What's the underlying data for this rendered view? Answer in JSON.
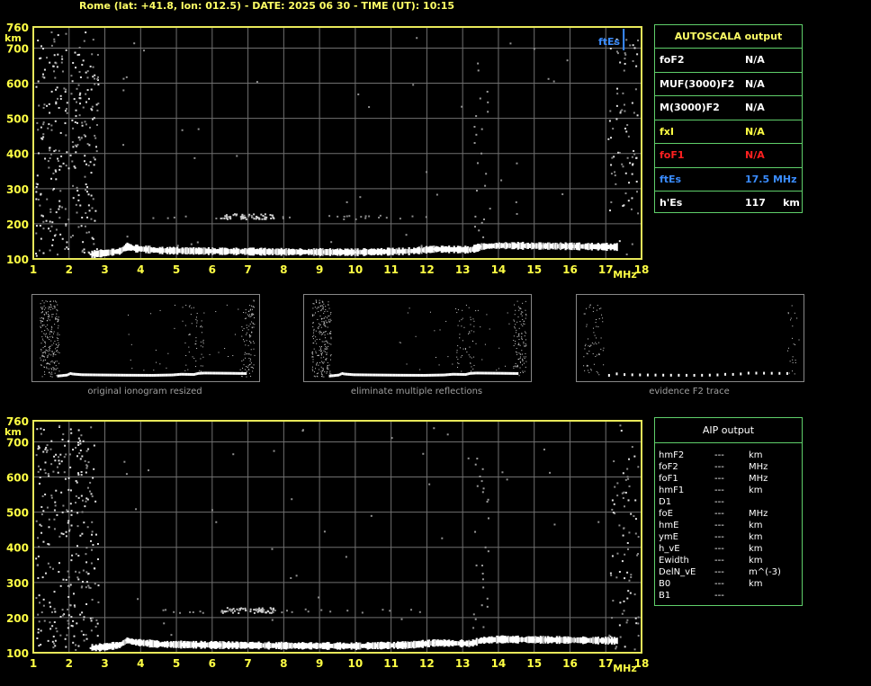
{
  "title": "Rome (lat: +41.8, lon: 012.5) - DATE: 2025 06 30 - TIME (UT): 10:15",
  "chart_data": [
    {
      "type": "scatter",
      "name": "ionogram-top",
      "xlabel": "MHz",
      "ylabel": "km",
      "xlim": [
        1,
        18
      ],
      "ylim": [
        100,
        760
      ],
      "x_ticks": [
        "1",
        "2",
        "3",
        "4",
        "5",
        "6",
        "7",
        "8",
        "9",
        "10",
        "11",
        "12",
        "13",
        "14",
        "15",
        "16",
        "17",
        "18"
      ],
      "y_ticks": [
        "760",
        "700",
        "600",
        "500",
        "400",
        "300",
        "200",
        "100"
      ],
      "trace": [
        [
          2.6,
          113
        ],
        [
          3.0,
          117
        ],
        [
          3.4,
          122
        ],
        [
          3.6,
          135
        ],
        [
          3.8,
          130
        ],
        [
          4.5,
          124
        ],
        [
          6,
          122
        ],
        [
          8,
          120
        ],
        [
          10,
          119
        ],
        [
          11.5,
          122
        ],
        [
          12.2,
          128
        ],
        [
          13.2,
          126
        ],
        [
          13.5,
          135
        ],
        [
          14,
          138
        ],
        [
          15,
          137
        ],
        [
          16,
          136
        ],
        [
          17.3,
          134
        ]
      ],
      "ftEs_marker": {
        "label": "ftEs",
        "x": 17.5,
        "color": "#3a8cff"
      }
    },
    {
      "type": "scatter",
      "name": "ionogram-bottom",
      "xlabel": "MHz",
      "ylabel": "km",
      "xlim": [
        1,
        18
      ],
      "ylim": [
        100,
        760
      ],
      "x_ticks": [
        "1",
        "2",
        "3",
        "4",
        "5",
        "6",
        "7",
        "8",
        "9",
        "10",
        "11",
        "12",
        "13",
        "14",
        "15",
        "16",
        "17",
        "18"
      ],
      "y_ticks": [
        "760",
        "700",
        "600",
        "500",
        "400",
        "300",
        "200",
        "100"
      ],
      "trace": [
        [
          2.6,
          113
        ],
        [
          3.0,
          117
        ],
        [
          3.4,
          122
        ],
        [
          3.6,
          135
        ],
        [
          3.8,
          130
        ],
        [
          4.5,
          124
        ],
        [
          6,
          122
        ],
        [
          8,
          120
        ],
        [
          10,
          119
        ],
        [
          11.5,
          122
        ],
        [
          12.2,
          128
        ],
        [
          13.2,
          126
        ],
        [
          13.5,
          135
        ],
        [
          14,
          138
        ],
        [
          15,
          137
        ],
        [
          16,
          136
        ],
        [
          17.3,
          134
        ]
      ]
    }
  ],
  "autoscala": {
    "title": "AUTOSCALA output",
    "rows": [
      {
        "label": "foF2",
        "value": "N/A",
        "color": "#ffffff"
      },
      {
        "label": "MUF(3000)F2",
        "value": "N/A",
        "color": "#ffffff"
      },
      {
        "label": "M(3000)F2",
        "value": "N/A",
        "color": "#ffffff"
      },
      {
        "label": "fxI",
        "value": "N/A",
        "color": "#ffff44"
      },
      {
        "label": "foF1",
        "value": "N/A",
        "color": "#ff2020"
      },
      {
        "label": "ftEs",
        "value": "17.5 MHz",
        "color": "#3a8cff"
      },
      {
        "label": "h'Es",
        "value": "117     km",
        "color": "#ffffff"
      }
    ]
  },
  "thumbnails": [
    {
      "caption": "original ionogram resized"
    },
    {
      "caption": "eliminate multiple reflections"
    },
    {
      "caption": "evidence F2 trace"
    }
  ],
  "aip": {
    "title": "AIP output",
    "rows": [
      {
        "label": "hmF2",
        "value": "---",
        "unit": "km"
      },
      {
        "label": "foF2",
        "value": "---",
        "unit": "MHz"
      },
      {
        "label": "foF1",
        "value": "---",
        "unit": "MHz"
      },
      {
        "label": "hmF1",
        "value": "---",
        "unit": "km"
      },
      {
        "label": "D1",
        "value": "---",
        "unit": ""
      },
      {
        "label": "foE",
        "value": "---",
        "unit": "MHz"
      },
      {
        "label": "hmE",
        "value": "---",
        "unit": "km"
      },
      {
        "label": "ymE",
        "value": "---",
        "unit": "km"
      },
      {
        "label": "h_vE",
        "value": "---",
        "unit": "km"
      },
      {
        "label": "Ewidth",
        "value": "---",
        "unit": "km"
      },
      {
        "label": "DelN_vE",
        "value": "---",
        "unit": "m^(-3)"
      },
      {
        "label": "B0",
        "value": "---",
        "unit": "km"
      },
      {
        "label": "B1",
        "value": "---",
        "unit": ""
      }
    ]
  }
}
